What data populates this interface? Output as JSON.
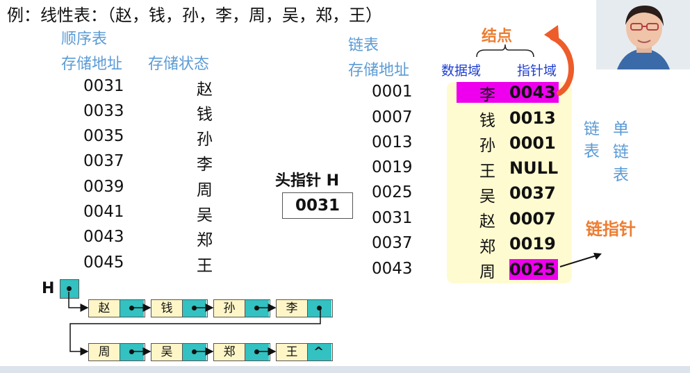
{
  "title": "例：线性表：（赵，钱，孙，李，周，吴，郑，王）",
  "sequential": {
    "title": "顺序表",
    "col_addr": "存储地址",
    "col_state": "存储状态",
    "rows": [
      {
        "addr": "0031",
        "val": "赵"
      },
      {
        "addr": "0033",
        "val": "钱"
      },
      {
        "addr": "0035",
        "val": "孙"
      },
      {
        "addr": "0037",
        "val": "李"
      },
      {
        "addr": "0039",
        "val": "周"
      },
      {
        "addr": "0041",
        "val": "吴"
      },
      {
        "addr": "0043",
        "val": "郑"
      },
      {
        "addr": "0045",
        "val": "王"
      }
    ]
  },
  "head": {
    "label": "头指针 H",
    "value": "0031"
  },
  "linked": {
    "title": "链表",
    "col_addr": "存储地址",
    "node_label": "结点",
    "data_field": "数据域",
    "ptr_field": "指针域",
    "rows": [
      {
        "addr": "0001",
        "val": "李",
        "next": "0043",
        "hl": true
      },
      {
        "addr": "0007",
        "val": "钱",
        "next": "0013",
        "hl": false
      },
      {
        "addr": "0013",
        "val": "孙",
        "next": "0001",
        "hl": false
      },
      {
        "addr": "0019",
        "val": "王",
        "next": "NULL",
        "hl": false
      },
      {
        "addr": "0025",
        "val": "吴",
        "next": "0037",
        "hl": false
      },
      {
        "addr": "0031",
        "val": "赵",
        "next": "0007",
        "hl": false
      },
      {
        "addr": "0037",
        "val": "郑",
        "next": "0019",
        "hl": false
      },
      {
        "addr": "0043",
        "val": "周",
        "next": "0025",
        "hl": true
      }
    ]
  },
  "side_labels": {
    "chain": "链表",
    "single_chain": "单链表",
    "chain_pointer": "链指针"
  },
  "chain_diagram": {
    "head": "H",
    "row1": [
      "赵",
      "钱",
      "孙",
      "李"
    ],
    "row2": [
      "周",
      "吴",
      "郑",
      "王"
    ],
    "null_symbol": "^"
  },
  "colors": {
    "blue_label": "#5b9bd5",
    "node_label": "#ed7d31",
    "highlight": "#ee00ee",
    "panel": "#fffbd0",
    "pointer_cell": "#33c1c1",
    "data_cell": "#fff6c8"
  }
}
